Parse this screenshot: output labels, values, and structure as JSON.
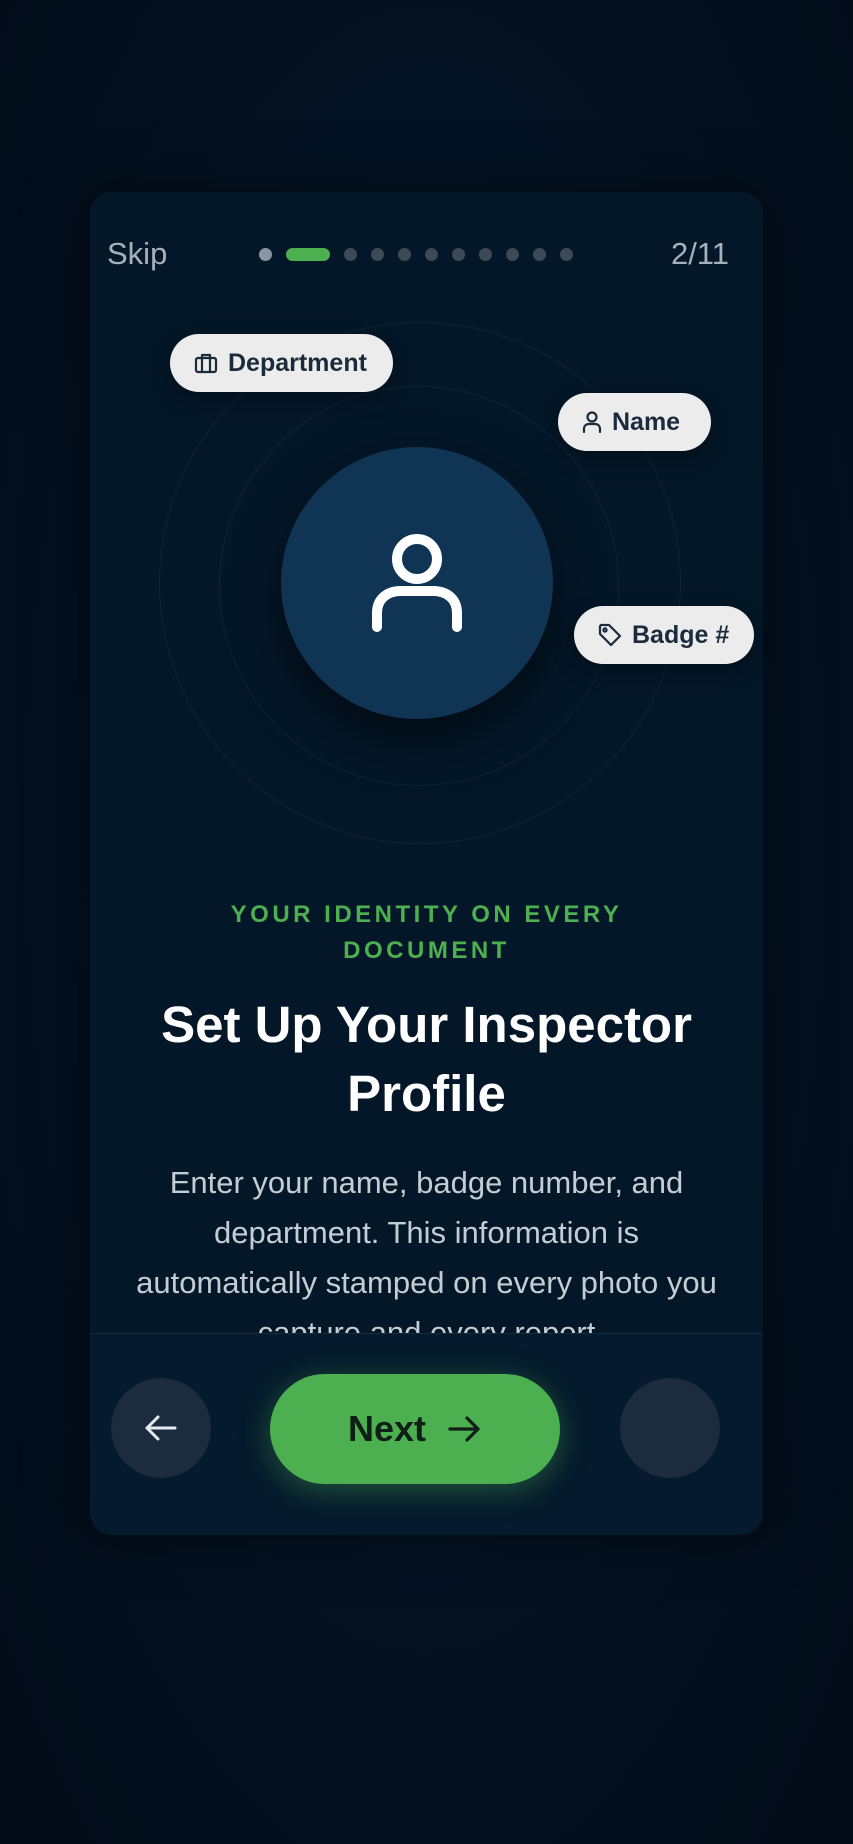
{
  "header": {
    "skip_label": "Skip",
    "progress": {
      "current": 2,
      "total": 11,
      "label": "2/11"
    }
  },
  "hero": {
    "avatar_icon": "user-icon",
    "chips": [
      {
        "label": "Department",
        "icon": "briefcase-icon"
      },
      {
        "label": "Name",
        "icon": "user-icon"
      },
      {
        "label": "Badge #",
        "icon": "tag-icon"
      }
    ]
  },
  "content": {
    "eyebrow": "YOUR IDENTITY ON EVERY DOCUMENT",
    "title": "Set Up Your Inspector Profile",
    "description": "Enter your name, badge number, and department. This information is automatically stamped on every photo you capture and every report"
  },
  "footer": {
    "back_icon": "arrow-left-icon",
    "next_label": "Next",
    "next_icon": "arrow-right-icon"
  },
  "colors": {
    "accent": "#4caf50",
    "background": "#020e1c",
    "card": "#041728",
    "avatar": "#0f3454",
    "chip": "#ececec"
  }
}
